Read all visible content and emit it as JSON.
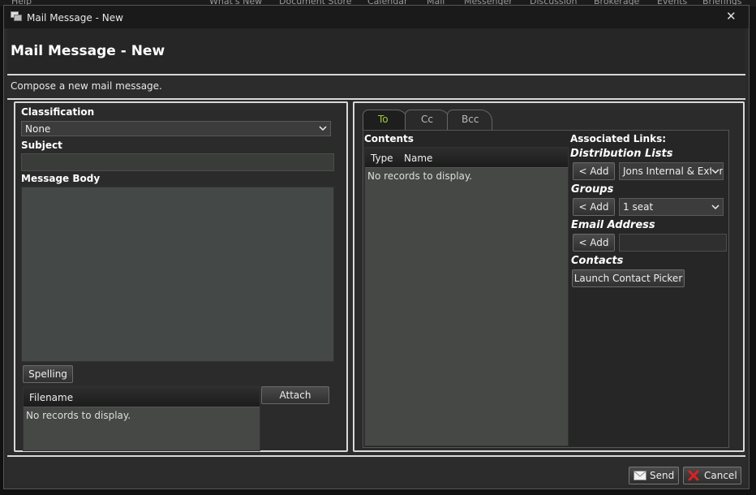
{
  "background_menu": [
    "Help",
    "What's New",
    "Document Store",
    "Calendar",
    "Mail",
    "Messenger",
    "Discussion",
    "Brokerage",
    "Events",
    "Briefings"
  ],
  "window": {
    "title": "Mail Message - New",
    "close_glyph": "✕"
  },
  "header": {
    "title": "Mail Message - New",
    "description": "Compose a new mail message."
  },
  "left": {
    "classification_label": "Classification",
    "classification_value": "None",
    "subject_label": "Subject",
    "subject_value": "",
    "body_label": "Message Body",
    "body_value": "",
    "spelling_button": "Spelling",
    "attach_button": "Attach",
    "attachments": {
      "column": "Filename",
      "empty": "No records to display."
    }
  },
  "recipients": {
    "tabs": [
      {
        "label": "To",
        "active": true
      },
      {
        "label": "Cc",
        "active": false
      },
      {
        "label": "Bcc",
        "active": false
      }
    ],
    "contents_label": "Contents",
    "columns": [
      "Type",
      "Name"
    ],
    "empty": "No records to display.",
    "links_title": "Associated Links:",
    "distribution_lists": {
      "label": "Distribution Lists",
      "add": "< Add",
      "selected": "Jons Internal & External"
    },
    "groups": {
      "label": "Groups",
      "add": "< Add",
      "selected": "1 seat"
    },
    "email_address": {
      "label": "Email Address",
      "add": "< Add",
      "value": ""
    },
    "contacts": {
      "label": "Contacts",
      "button": "Launch Contact Picker"
    }
  },
  "footer": {
    "send": "Send",
    "cancel": "Cancel"
  },
  "colors": {
    "active_tab_text": "#9ccc3a",
    "cancel_icon": "#e02020",
    "panel_border": "#d8d8d8"
  },
  "icons": [
    "app-window-icon",
    "close-icon",
    "chevron-down-icon",
    "envelope-icon",
    "cancel-x-icon"
  ]
}
